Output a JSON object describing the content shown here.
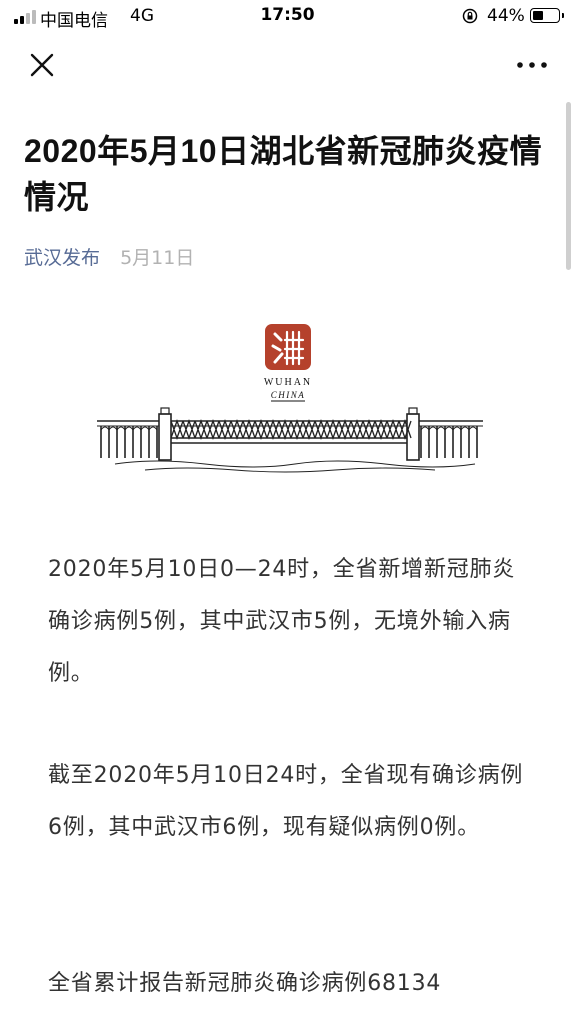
{
  "status_bar": {
    "carrier": "中国电信",
    "network": "4G",
    "time": "17:50",
    "battery_percent": "44%",
    "battery_level": 0.44,
    "lock_icon": "orientation-lock-icon"
  },
  "nav": {
    "close_icon": "close-icon",
    "more_icon": "more-icon"
  },
  "article": {
    "title": "2020年5月10日湖北省新冠肺炎疫情情况",
    "author": "武汉发布",
    "date": "5月11日",
    "banner": {
      "logo_text_line1": "WUHAN",
      "logo_text_line2": "CHINA",
      "seal_color": "#b5412c",
      "image_name": "wuhan-bridge-illustration"
    },
    "paragraphs": [
      "2020年5月10日0—24时，全省新增新冠肺炎确诊病例5例，其中武汉市5例，无境外输入病例。",
      "截至2020年5月10日24时，全省现有确诊病例6例，其中武汉市6例，现有疑似病例0例。",
      "全省累计报告新冠肺炎确诊病例68134"
    ]
  },
  "colors": {
    "author_link": "#576b95",
    "meta_gray": "#b2b2b2",
    "body_text": "#333333"
  }
}
